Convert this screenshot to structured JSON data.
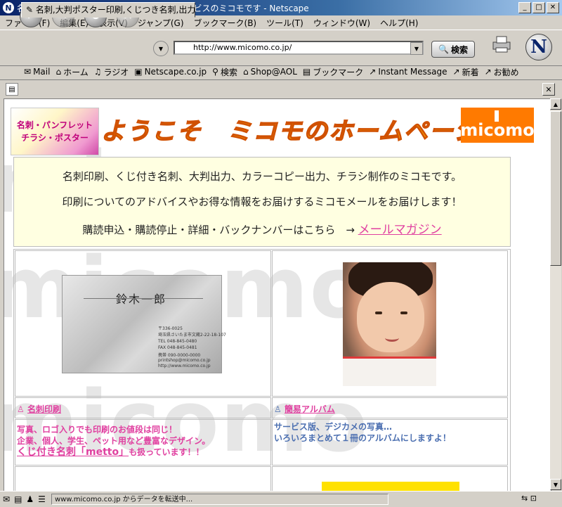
{
  "window": {
    "title": "名刺,大判ポスター印刷,くじつき名刺,出力サービスのミコモです - Netscape"
  },
  "menu": [
    "ファイル(F)",
    "編集(E)",
    "表示(V)",
    "ジャンプ(G)",
    "ブックマーク(B)",
    "ツール(T)",
    "ウィンドウ(W)",
    "ヘルプ(H)"
  ],
  "nav": {
    "url": "http://www.micomo.co.jp/",
    "search_label": "検索"
  },
  "personal_bar": [
    {
      "icon": "mail-icon",
      "label": "Mail"
    },
    {
      "icon": "home-icon",
      "label": "ホーム"
    },
    {
      "icon": "radio-icon",
      "label": "ラジオ"
    },
    {
      "icon": "my-icon",
      "label": "Netscape.co.jp"
    },
    {
      "icon": "search-icon",
      "label": "検索"
    },
    {
      "icon": "shop-icon",
      "label": "Shop@AOL"
    },
    {
      "icon": "bookmark-icon",
      "label": "ブックマーク"
    },
    {
      "icon": "link-icon",
      "label": "Instant Message"
    },
    {
      "icon": "link-icon",
      "label": "新着"
    },
    {
      "icon": "link-icon",
      "label": "お勧め"
    }
  ],
  "tab": {
    "label": "名刺,大判ポスター印刷,くじつき名刺,出力サ..."
  },
  "page": {
    "banner_left_lines": [
      "名刺・パンフレット",
      "チラシ・ポスター"
    ],
    "banner_title": "ようこそ　ミコモのホームページへ！",
    "logo_text": "micomo",
    "watermark": "micomo",
    "info_line1": "名刺印刷、くじ付き名刺、大判出力、カラーコピー出力、チラシ制作のミコモです。",
    "info_line2": "印刷についてのアドバイスやお得な情報をお届けするミコモメールをお届けします！",
    "info_line3": "購読申込・購読停止・詳細・バックナンバーはこちら　→",
    "info_link": "メールマガジン",
    "card": {
      "name": "鈴木一郎",
      "lines": [
        "〒336-0025",
        "埼玉県さいたま市文蔵2-22-18-107",
        "TEL 048-845-0480",
        "FAX 048-845-0481",
        "携帯 090-0000-0000",
        "printshop@micomo.co.jp",
        "http://www.micomo.co.jp"
      ]
    },
    "left": {
      "title": "名刺印刷",
      "desc1": "写真、ロゴ入りでも印刷のお値段は同じ！",
      "desc2": "企業、個人、学生、ペット用など豊富なデザイン。",
      "desc3_link": "くじ付き名刺「metto」",
      "desc3_rest": "も扱っています！！"
    },
    "right": {
      "title": "簡易アルバム",
      "desc1": "サービス版、デジカメの写真…",
      "desc2": "いろいろまとめて１冊のアルバムにしますよ！"
    }
  },
  "status": {
    "text": "www.micomo.co.jp からデータを転送中..."
  },
  "colors": {
    "pink": "#e040a0",
    "blue": "#4a6eb0",
    "orange": "#ff7a00"
  }
}
